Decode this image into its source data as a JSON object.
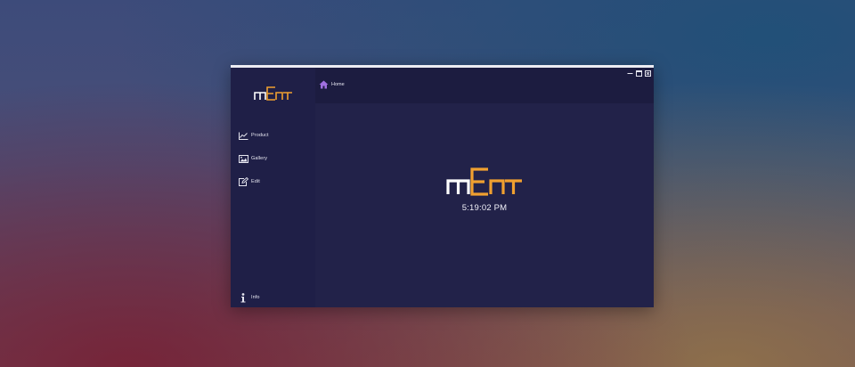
{
  "app": {
    "logo_text": "mEnT",
    "accent_color": "#f0a030",
    "logo_m_color": "#ffffff"
  },
  "sidebar": {
    "items": [
      {
        "label": "Product",
        "icon": "line-chart-icon"
      },
      {
        "label": "Gallery",
        "icon": "image-icon"
      },
      {
        "label": "Edit",
        "icon": "edit-icon"
      }
    ],
    "footer": {
      "label": "Info",
      "icon": "info-icon"
    }
  },
  "header": {
    "home_label": "Home",
    "home_icon": "home-icon",
    "home_icon_color": "#a070e0"
  },
  "window_controls": [
    "minimize-icon",
    "maximize-icon",
    "close-icon"
  ],
  "main": {
    "clock": "5:19:02 PM"
  },
  "colors": {
    "sidebar_bg": "#1f1f47",
    "header_bg": "#1c1c40",
    "content_bg": "#222249"
  }
}
